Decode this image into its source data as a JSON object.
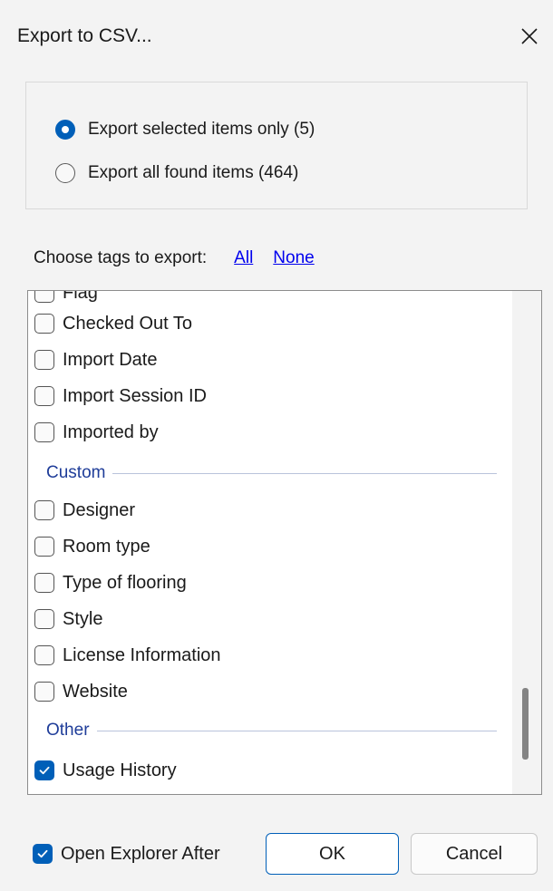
{
  "dialog": {
    "title": "Export to CSV..."
  },
  "scope": {
    "selected_label": "Export selected items only (5)",
    "all_label": "Export all found items (464)",
    "selected_checked": true
  },
  "tags": {
    "prompt": "Choose tags to export:",
    "all_link": "All",
    "none_link": "None"
  },
  "list": {
    "items": [
      {
        "label": "Flag",
        "checked": false
      },
      {
        "label": "Checked Out To",
        "checked": false
      },
      {
        "label": "Import Date",
        "checked": false
      },
      {
        "label": "Import Session ID",
        "checked": false
      },
      {
        "label": "Imported by",
        "checked": false
      }
    ],
    "custom_header": "Custom",
    "custom_items": [
      {
        "label": "Designer",
        "checked": false
      },
      {
        "label": "Room type",
        "checked": false
      },
      {
        "label": "Type of flooring",
        "checked": false
      },
      {
        "label": "Style",
        "checked": false
      },
      {
        "label": "License Information",
        "checked": false
      },
      {
        "label": "Website",
        "checked": false
      }
    ],
    "other_header": "Other",
    "other_items": [
      {
        "label": "Usage History",
        "checked": true
      }
    ]
  },
  "footer": {
    "open_explorer_label": "Open Explorer After",
    "open_explorer_checked": true,
    "ok_label": "OK",
    "cancel_label": "Cancel"
  },
  "colors": {
    "accent": "#005fb8",
    "link": "#0000ee",
    "section": "#1f3d99"
  }
}
